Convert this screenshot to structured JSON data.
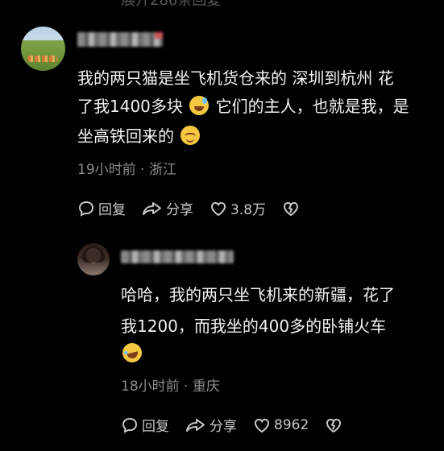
{
  "header": {
    "faded_text": "展开286条回复"
  },
  "comments": [
    {
      "text_line1": "我的两只猫是坐飞机货仓来的 深圳到杭州 花",
      "text_line2a": "了我1400多块",
      "text_line2b": "它们的主人，也就是我，是",
      "text_line3": "坐高铁回来的",
      "meta": "19小时前 · 浙江",
      "reply_label": "回复",
      "share_label": "分享",
      "like_count": "3.8万"
    },
    {
      "text_line1": "哈哈，我的两只坐飞机来的新疆，花了",
      "text_line2": "我1200，而我坐的400多的卧铺火车",
      "meta": "18小时前 · 重庆",
      "reply_label": "回复",
      "share_label": "分享",
      "like_count": "8962"
    }
  ],
  "icons": {
    "reply": "reply-bubble-icon",
    "share": "share-arrow-icon",
    "like": "heart-outline-icon",
    "dislike": "broken-heart-icon"
  },
  "colors": {
    "background": "#000000",
    "text": "#f2f2f2",
    "meta": "#8b8b8b"
  }
}
